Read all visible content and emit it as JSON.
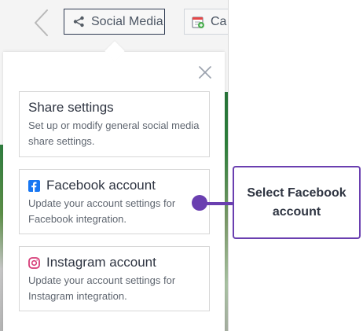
{
  "toolbar": {
    "back_icon": "chevron-left-icon",
    "social_media_label": "Social Media",
    "social_media_icon": "share-icon",
    "calendar_label": "Ca",
    "calendar_icon": "calendar-icon"
  },
  "dropdown": {
    "close_icon": "close-icon",
    "items": [
      {
        "title": "Share settings",
        "description": "Set up or modify general social media share settings."
      },
      {
        "title": "Facebook account",
        "description": "Update your account settings for Facebook integration.",
        "icon": "facebook-icon"
      },
      {
        "title": "Instagram account",
        "description": "Update your account settings for Instagram integration.",
        "icon": "instagram-icon"
      }
    ]
  },
  "callout": {
    "text": "Select Facebook account"
  },
  "colors": {
    "accent": "#6a3fb0",
    "border": "#d7d7d7",
    "text": "#2f3542",
    "muted_text": "#5f6670",
    "facebook": "#1877f2",
    "instagram": "#d63c78"
  }
}
